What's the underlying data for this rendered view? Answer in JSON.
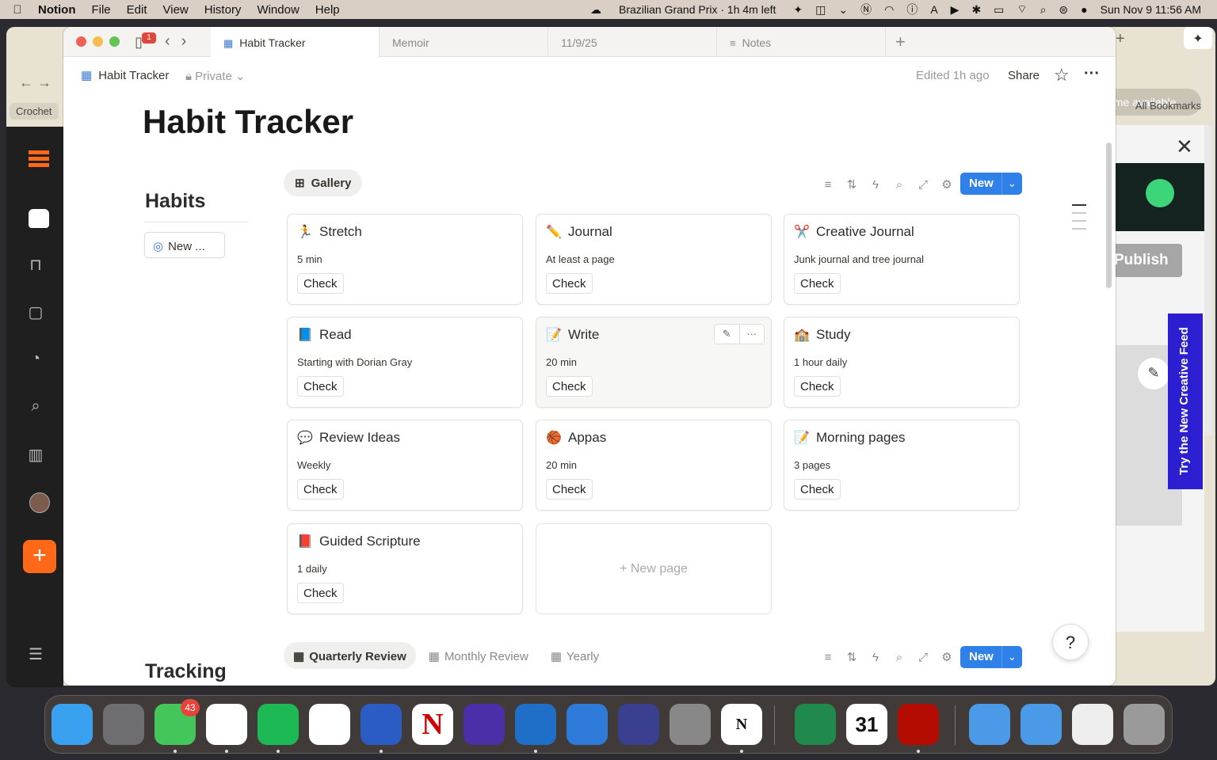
{
  "menubar": {
    "app_name": "Notion",
    "menus": [
      "File",
      "Edit",
      "View",
      "History",
      "Window",
      "Help"
    ],
    "now_playing": "Brazilian Grand Prix · 1h 4m left",
    "datetime": "Sun Nov 9  11:56 AM",
    "keyboard_indicator": "A"
  },
  "background_browser": {
    "bookmark_chip": "Crochet",
    "all_bookmarks": "All Bookmarks",
    "update_pill": "ome available",
    "publish_label": "Publish",
    "feed_label": "Try the New Creative Feed"
  },
  "tabs": {
    "badge_count": "1",
    "items": [
      {
        "label": "Habit Tracker",
        "icon": "grid-icon"
      },
      {
        "label": "Memoir",
        "icon": ""
      },
      {
        "label": "11/9/25",
        "icon": ""
      },
      {
        "label": "Notes",
        "icon": "notes-icon"
      }
    ]
  },
  "topbar": {
    "breadcrumb": "Habit Tracker",
    "privacy": "Private",
    "edited": "Edited 1h ago",
    "share": "Share"
  },
  "page": {
    "title": "Habit Tracker",
    "habits_heading": "Habits",
    "new_habit_button": "New ...",
    "gallery_view": "Gallery",
    "new_button": "New",
    "new_page": "+ New page",
    "tracking_heading": "Tracking",
    "check_label": "Check"
  },
  "habits": [
    {
      "name": "Stretch",
      "detail": "5 min",
      "emoji": "🏃"
    },
    {
      "name": "Journal",
      "detail": "At least a page",
      "emoji": "✏️"
    },
    {
      "name": "Creative Journal",
      "detail": "Junk journal and tree journal",
      "emoji": "✂️"
    },
    {
      "name": "Read",
      "detail": "Starting with Dorian Gray",
      "emoji": "📘"
    },
    {
      "name": "Write",
      "detail": "20 min",
      "emoji": "📝"
    },
    {
      "name": "Study",
      "detail": "1 hour daily",
      "emoji": "🏫"
    },
    {
      "name": "Review Ideas",
      "detail": "Weekly",
      "emoji": "💬"
    },
    {
      "name": "Appas",
      "detail": "20 min",
      "emoji": "🏀"
    },
    {
      "name": "Morning pages",
      "detail": "3 pages",
      "emoji": "📝"
    },
    {
      "name": "Guided Scripture",
      "detail": "1 daily",
      "emoji": "📕"
    }
  ],
  "tracking_views": [
    {
      "label": "Quarterly Review",
      "active": true
    },
    {
      "label": "Monthly Review",
      "active": false
    },
    {
      "label": "Yearly",
      "active": false
    }
  ],
  "dock": {
    "messages_badge": "43",
    "apps": [
      "Finder",
      "System Settings",
      "Messages",
      "Chrome",
      "Spotify",
      "Arc",
      "Word",
      "Nebraska",
      "Obsidian",
      "Outlook",
      "Windows App",
      "Game",
      "iPhone Mirroring",
      "Notion",
      "Excel",
      "Calendar",
      "Acrobat",
      "Applications",
      "Downloads",
      "Screenshot",
      "Trash"
    ],
    "calendar_day": "31"
  },
  "colors": {
    "accent": "#2f80e8",
    "substack_orange": "#ff6719"
  }
}
